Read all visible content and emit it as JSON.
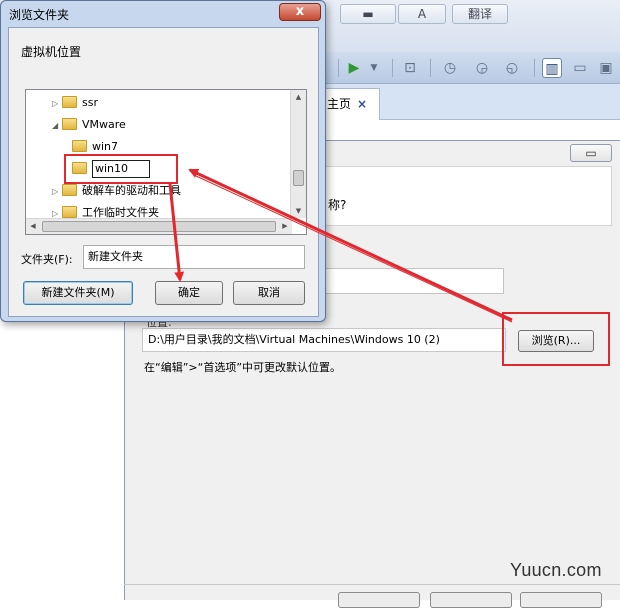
{
  "background": {
    "home_tab": {
      "label": "主页",
      "close": "×"
    },
    "wizard_question": "称?",
    "location_label": "位置:",
    "location_value": "D:\\用户目录\\我的文档\\Virtual Machines\\Windows 10 (2)",
    "browse_label": "浏览(R)...",
    "hint": "在“编辑”>“首选项”中可更改默认位置。",
    "caption_text": "翻译"
  },
  "browse_dialog": {
    "title": "浏览文件夹",
    "close": "x",
    "description": "虚拟机位置",
    "tree": [
      {
        "label": "ssr",
        "arrow": "▷"
      },
      {
        "label": "VMware",
        "arrow": "◢"
      },
      {
        "label": "win7",
        "arrow": ""
      },
      {
        "label": "win10",
        "arrow": ""
      },
      {
        "label": "破解车的驱动和工具",
        "arrow": "▷"
      },
      {
        "label": "工作临时文件夹",
        "arrow": "▷"
      }
    ],
    "folder_label": "文件夹(F):",
    "folder_value": "新建文件夹",
    "new_folder_button": "新建文件夹(M)",
    "ok_button": "确定",
    "cancel_button": "取消"
  },
  "watermark": "Yuucn.com",
  "colors": {
    "annotation": "#e0282e",
    "dialog_frame": "#c7d8ee"
  }
}
